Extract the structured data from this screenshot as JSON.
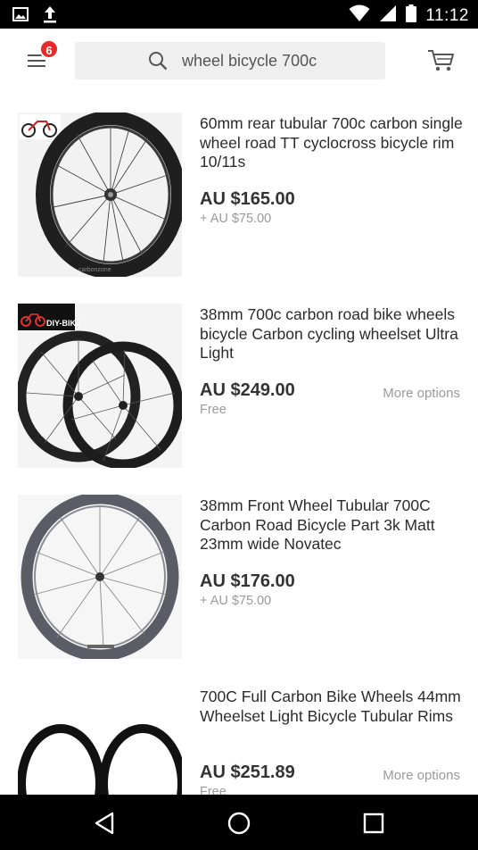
{
  "status_bar": {
    "time": "11:12",
    "icons": [
      "image-icon",
      "upload-icon",
      "wifi-icon",
      "cell-signal-icon",
      "battery-icon"
    ]
  },
  "app_bar": {
    "menu_icon": "hamburger-menu-icon",
    "badge_count": "6",
    "search_query": "wheel bicycle 700c",
    "search_icon": "search-icon",
    "cart_icon": "cart-icon",
    "badge_color": "#e52a2a"
  },
  "results": [
    {
      "title": "60mm rear tubular 700c carbon single wheel road TT cyclocross bicycle rim 10/11s",
      "price": "AU $165.00",
      "shipping": "+ AU $75.00",
      "more_options": "",
      "image": "rear-wheel-photo",
      "image_watermark": "carbonzone"
    },
    {
      "title": "38mm 700c carbon road bike wheels bicycle Carbon cycling wheelset Ultra Light",
      "price": "AU $249.00",
      "shipping": "Free",
      "more_options": "More options",
      "image": "wheelset-photo",
      "image_logo": "DIY-BIKE"
    },
    {
      "title": "38mm Front Wheel Tubular 700C Carbon Road Bicycle Part 3k Matt 23mm wide Novatec",
      "price": "AU $176.00",
      "shipping": "+ AU $75.00",
      "more_options": "",
      "image": "front-wheel-photo"
    },
    {
      "title": "700C Full Carbon Bike Wheels 44mm Wheelset Light Bicycle Tubular Rims",
      "price": "AU $251.89",
      "shipping": "Free",
      "more_options": "More options",
      "image": "wheelset-rims-photo"
    }
  ],
  "nav_bar": {
    "back_icon": "back-triangle-icon",
    "home_icon": "home-circle-icon",
    "recents_icon": "recents-square-icon"
  }
}
